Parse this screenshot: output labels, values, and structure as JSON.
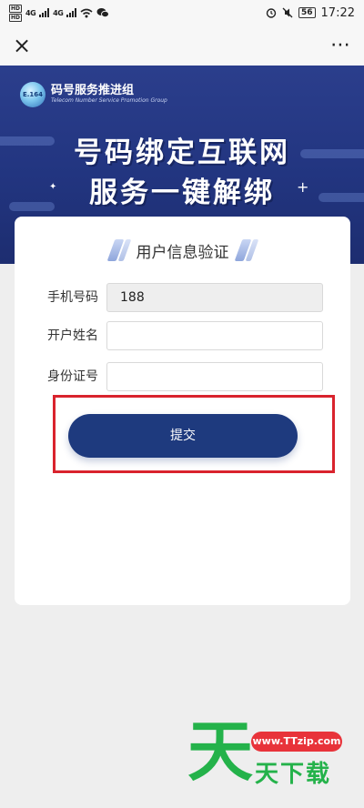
{
  "status_bar": {
    "sim1": "HD",
    "sim2": "HD",
    "net1": "4G",
    "net2": "4G",
    "battery": "56",
    "time": "17:22"
  },
  "title_bar": {
    "close": "×",
    "more": "⋯"
  },
  "banner": {
    "logo_text": "E.164",
    "org_name": "码号服务推进组",
    "org_sub": "Telecom Number Service  Promotion Group",
    "headline_1": "号码绑定互联网",
    "headline_2": "服务一键解绑"
  },
  "form": {
    "title": "用户信息验证",
    "fields": [
      {
        "label": "手机号码",
        "value": "188"
      },
      {
        "label": "开户姓名",
        "value": ""
      },
      {
        "label": "身份证号",
        "value": ""
      }
    ],
    "submit_label": "提交"
  },
  "watermark": {
    "big": "天",
    "url": "www.TTzip.com",
    "text": "天下载"
  },
  "colors": {
    "banner": "#223580",
    "button": "#1e3a7e",
    "highlight": "#d9232d",
    "watermark_green": "#24b24a",
    "watermark_red": "#e8333a"
  }
}
